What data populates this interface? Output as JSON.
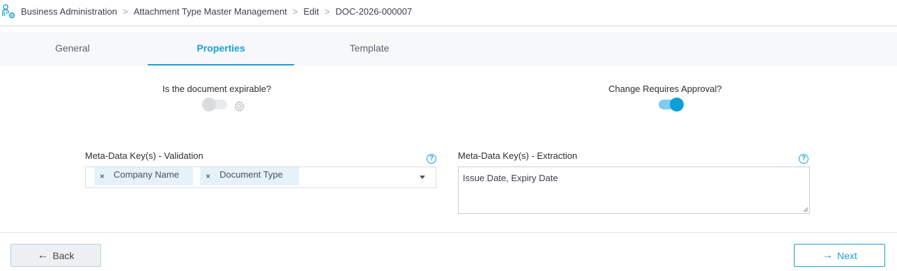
{
  "breadcrumb": [
    "Business Administration",
    "Attachment Type Master Management",
    "Edit",
    "DOC-2026-000007"
  ],
  "tabs": [
    {
      "label": "General",
      "active": false
    },
    {
      "label": "Properties",
      "active": true
    },
    {
      "label": "Template",
      "active": false
    }
  ],
  "expirable": {
    "label": "Is the document expirable?",
    "value": false
  },
  "approval": {
    "label": "Change Requires Approval?",
    "value": true
  },
  "validation": {
    "label": "Meta-Data Key(s) - Validation",
    "chips": [
      "Company Name",
      "Document Type"
    ],
    "chip_remove": "×"
  },
  "extraction": {
    "label": "Meta-Data Key(s) - Extraction",
    "value": "Issue Date, Expiry Date"
  },
  "help_glyph": "?",
  "footer": {
    "back_label": "Back",
    "next_label": "Next"
  },
  "colors": {
    "accent": "#1a9fd6",
    "toggle_on": "#0e9fd8",
    "chip_bg": "#e6f2fa"
  },
  "icons": {
    "logo": "settings-user-icon",
    "breadcrumb_sep": "chevron-right-icon",
    "gear": "gear-icon"
  }
}
